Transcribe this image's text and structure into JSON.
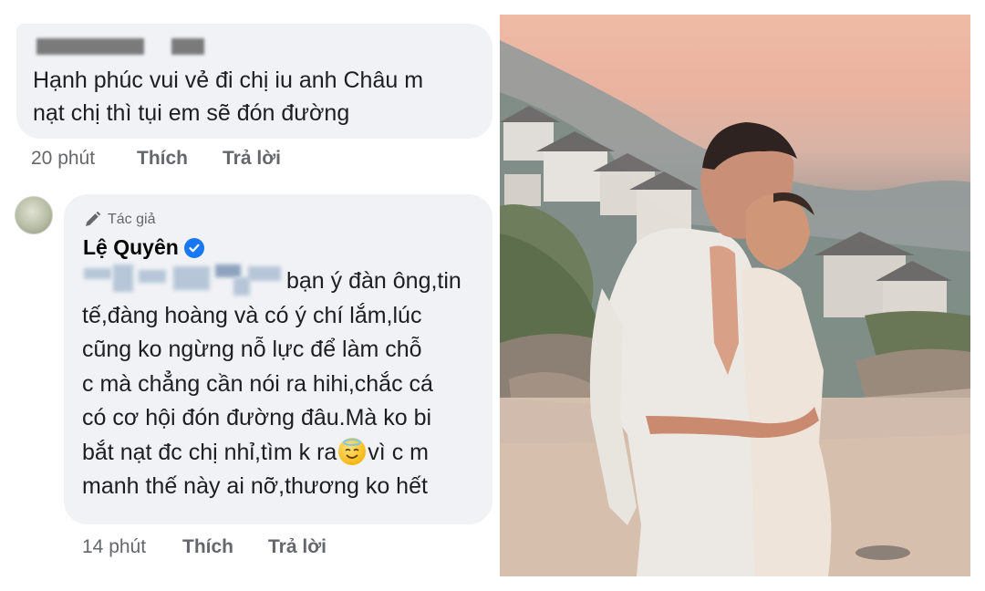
{
  "comment1": {
    "text_lines": [
      "Hạnh phúc vui vẻ đi chị iu anh Châu m",
      "nạt chị thì tụi em sẽ đón đường"
    ],
    "time": "20 phút",
    "like_label": "Thích",
    "reply_label": "Trả lời"
  },
  "comment2": {
    "badge": "Tác giả",
    "author": "Lệ Quyên",
    "text_lines": [
      "bạn ý đàn ông,tin",
      "tế,đàng hoàng và có ý chí lắm,lúc",
      "cũng ko ngừng nỗ lực để làm chỗ",
      "c mà chẳng cần nói ra hihi,chắc cá",
      "có cơ hội đón đường đâu.Mà ko bi",
      "bắt nạt đc chị nhỉ,tìm k ra",
      "vì c m",
      "manh thế này ai nỡ,thương ko hết"
    ],
    "emoji": "smiling-face-with-halo",
    "time": "14 phút",
    "like_label": "Thích",
    "reply_label": "Trả lời"
  },
  "colors": {
    "bubble": "#f0f2f5",
    "meta_text": "#65676b",
    "verified": "#1877f2"
  }
}
